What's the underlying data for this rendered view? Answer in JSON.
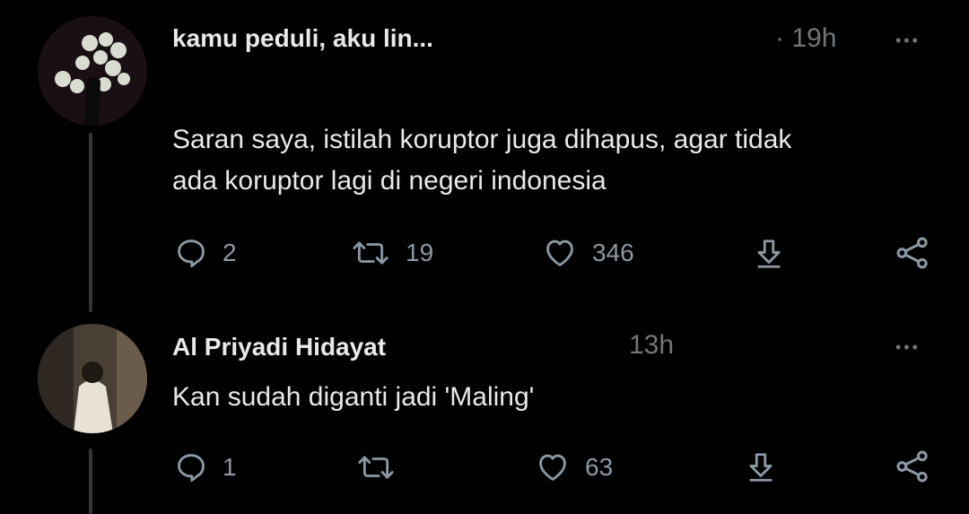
{
  "tweets": [
    {
      "author": "kamu peduli, aku lin...",
      "time": "· 19h",
      "more": "•••",
      "text_lines": [
        "Saran saya, istilah koruptor juga dihapus, agar tidak",
        "ada koruptor lagi di negeri indonesia"
      ],
      "replies": "2",
      "retweets": "19",
      "likes": "346"
    },
    {
      "author": "Al Priyadi Hidayat",
      "time": "13h",
      "more": "•••",
      "text_lines": [
        "Kan sudah diganti jadi 'Maling'"
      ],
      "replies": "1",
      "retweets": "",
      "likes": "63"
    }
  ],
  "icons": {
    "reply": "reply-icon",
    "retweet": "retweet-icon",
    "like": "heart-icon",
    "download": "download-icon",
    "share": "share-icon"
  },
  "colors": {
    "background": "#000000",
    "text": "#e7e9ea",
    "muted": "#71767b",
    "thread_line": "#333639"
  }
}
